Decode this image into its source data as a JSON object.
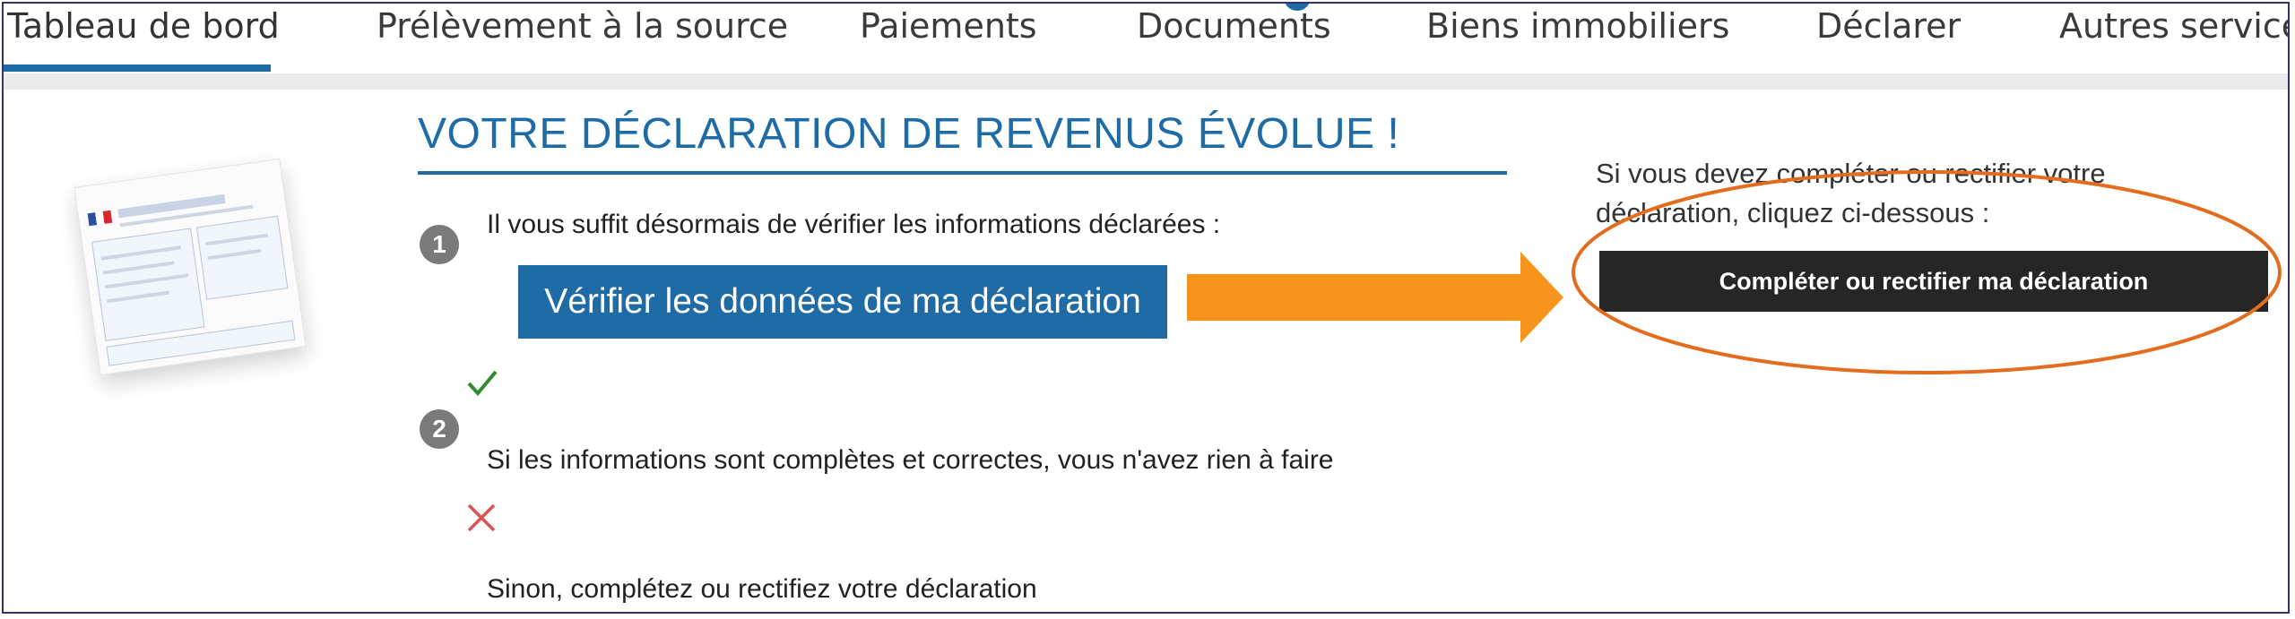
{
  "nav": {
    "items": [
      {
        "label": "Tableau de bord",
        "active": true
      },
      {
        "label": "Prélèvement à la source"
      },
      {
        "label": "Paiements"
      },
      {
        "label": "Documents"
      },
      {
        "label": "Biens immobiliers"
      },
      {
        "label": "Déclarer"
      },
      {
        "label": "Autres services"
      }
    ]
  },
  "main": {
    "title": "VOTRE DÉCLARATION DE REVENUS ÉVOLUE !",
    "step1": {
      "number": "1",
      "text": "Il vous suffit désormais de vérifier les informations déclarées :",
      "button": "Vérifier les données de ma déclaration"
    },
    "step2": {
      "number": "2",
      "ok_text": "Si les informations sont complètes et correctes, vous n'avez rien à faire",
      "ko_text": "Sinon, complétez ou rectifiez votre déclaration"
    }
  },
  "side": {
    "text": "Si vous devez compléter ou rectifier votre déclaration, cliquez ci-dessous :",
    "button": "Compléter ou rectifier ma déclaration"
  },
  "colors": {
    "accent": "#1f6ba5",
    "annotation_arrow": "#f7941d",
    "annotation_ellipse": "#e36c1e",
    "dark_button": "#262626",
    "check": "#2e8b2e",
    "cross": "#d9534f"
  },
  "icons": {
    "check": "check-icon",
    "cross": "cross-icon",
    "arrow": "right-arrow-icon",
    "document": "declaration-document-thumbnail"
  }
}
